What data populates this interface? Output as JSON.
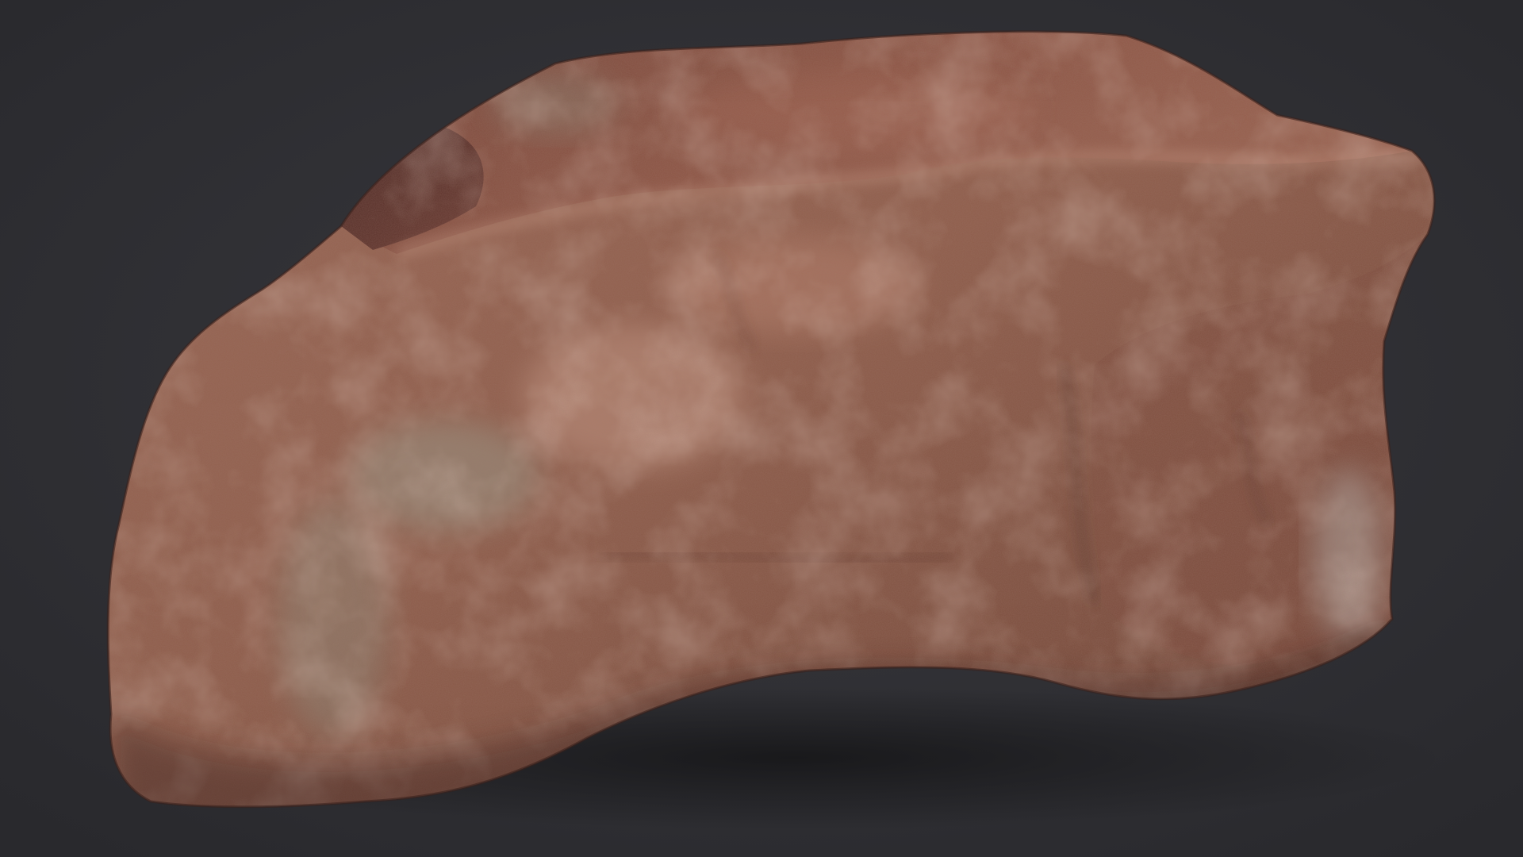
{
  "scene": {
    "subject": "red-sandstone-rock-3d-scan",
    "background_color": "#2f2f33",
    "rock_base_color": "#8a5a4a",
    "rock_highlight_color": "#c79a86",
    "rock_shadow_color": "#4a2a24",
    "lichen_color": "#8f9a8a"
  }
}
